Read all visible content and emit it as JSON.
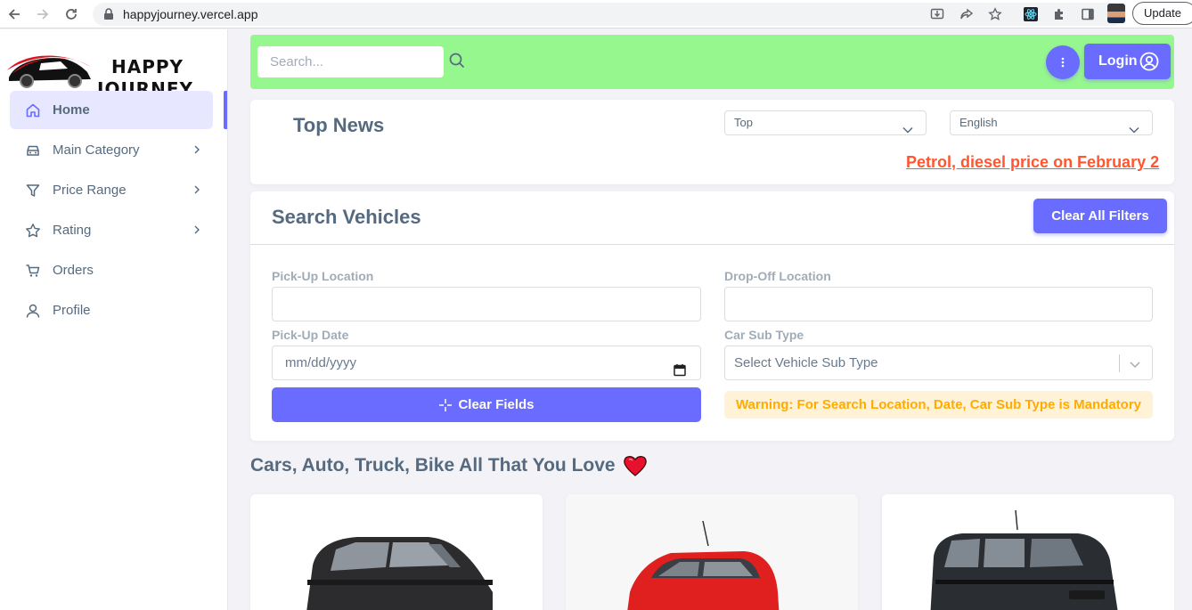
{
  "browser": {
    "url": "happyjourney.vercel.app",
    "update_label": "Update"
  },
  "brand": {
    "line1": "HAPPY",
    "line2": "JOURNEY"
  },
  "sidebar": {
    "items": [
      {
        "label": "Home",
        "icon": "home-icon",
        "active": true
      },
      {
        "label": "Main Category",
        "icon": "car-icon",
        "has_submenu": true
      },
      {
        "label": "Price Range",
        "icon": "filter-icon",
        "has_submenu": true
      },
      {
        "label": "Rating",
        "icon": "star-icon",
        "has_submenu": true
      },
      {
        "label": "Orders",
        "icon": "cart-icon"
      },
      {
        "label": "Profile",
        "icon": "user-icon"
      }
    ]
  },
  "header": {
    "search_placeholder": "Search...",
    "login_label": "Login"
  },
  "news": {
    "title": "Top News",
    "category_value": "Top",
    "language_value": "English",
    "ticker_text": "Petrol, diesel price on February 2"
  },
  "search_vehicles": {
    "title": "Search Vehicles",
    "clear_all_label": "Clear All Filters",
    "pickup_location_label": "Pick-Up Location",
    "dropoff_location_label": "Drop-Off Location",
    "pickup_date_label": "Pick-Up Date",
    "pickup_date_placeholder": "mm/dd/yyyy",
    "car_subtype_label": "Car Sub Type",
    "car_subtype_placeholder": "Select Vehicle Sub Type",
    "clear_fields_label": "Clear Fields",
    "warning_text": "Warning: For Search Location, Date, Car Sub Type is Mandatory"
  },
  "listing": {
    "heading": "Cars, Auto, Truck, Bike All That You Love"
  },
  "colors": {
    "accent": "#696cff",
    "header_bg": "#96f78e",
    "ticker": "#ff5630",
    "warning_text": "#ffab00",
    "warning_bg": "#fff2d6"
  }
}
